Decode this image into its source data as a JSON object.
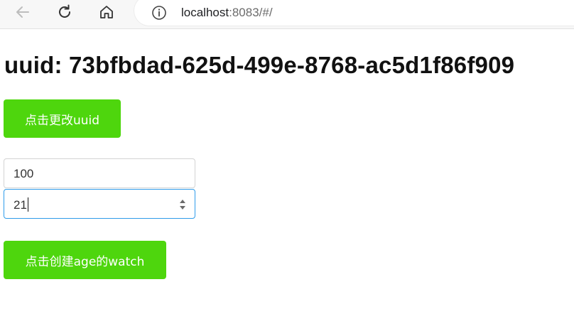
{
  "browser": {
    "url_host": "localhost",
    "url_rest": ":8083/#/",
    "icons": [
      "back-arrow-icon",
      "reload-icon",
      "home-icon",
      "info-icon"
    ]
  },
  "page": {
    "title": "uuid: 73bfbdad-625d-499e-8768-ac5d1f86f909",
    "change_uuid_button": "点击更改uuid",
    "input_one_value": "100",
    "input_two_value": "21",
    "create_watch_button": "点击创建age的watch"
  },
  "colors": {
    "button_green": "#4ed60d",
    "focus_border": "#2f9cea"
  }
}
